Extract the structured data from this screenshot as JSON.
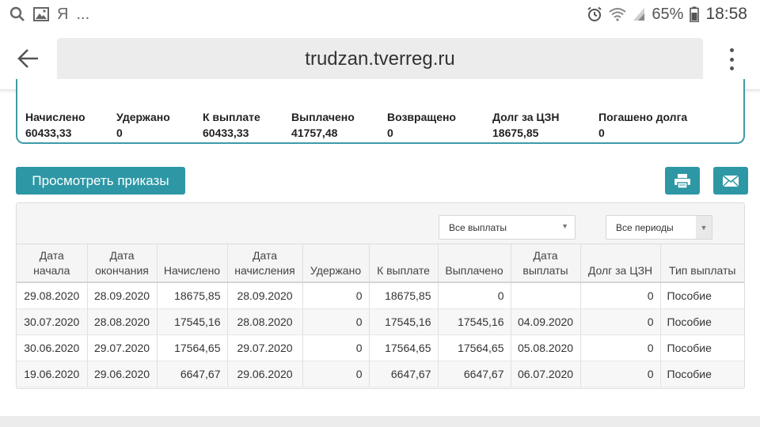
{
  "status_bar": {
    "carrier_glyph": "Я",
    "more": "...",
    "battery": "65%",
    "time": "18:58"
  },
  "browser": {
    "url": "trudzan.tverreg.ru"
  },
  "summary": {
    "items": [
      {
        "label": "Начислено",
        "value": "60433,33"
      },
      {
        "label": "Удержано",
        "value": "0"
      },
      {
        "label": "К выплате",
        "value": "60433,33"
      },
      {
        "label": "Выплачено",
        "value": "41757,48"
      },
      {
        "label": "Возвращено",
        "value": "0"
      },
      {
        "label": "Долг за ЦЗН",
        "value": "18675,85"
      },
      {
        "label": "Погашено долга",
        "value": "0"
      }
    ]
  },
  "actions": {
    "view_orders": "Просмотреть приказы"
  },
  "filters": {
    "payments": "Все выплаты",
    "periods": "Все периоды"
  },
  "table": {
    "headers": [
      "Дата начала",
      "Дата окончания",
      "Начислено",
      "Дата начисления",
      "Удержано",
      "К выплате",
      "Выплачено",
      "Дата выплаты",
      "Долг за ЦЗН",
      "Тип выплаты"
    ],
    "rows": [
      [
        "29.08.2020",
        "28.09.2020",
        "18675,85",
        "28.09.2020",
        "0",
        "18675,85",
        "0",
        "",
        "0",
        "Пособие"
      ],
      [
        "30.07.2020",
        "28.08.2020",
        "17545,16",
        "28.08.2020",
        "0",
        "17545,16",
        "17545,16",
        "04.09.2020",
        "0",
        "Пособие"
      ],
      [
        "30.06.2020",
        "29.07.2020",
        "17564,65",
        "29.07.2020",
        "0",
        "17564,65",
        "17564,65",
        "05.08.2020",
        "0",
        "Пособие"
      ],
      [
        "19.06.2020",
        "29.06.2020",
        "6647,67",
        "29.06.2020",
        "0",
        "6647,67",
        "6647,67",
        "06.07.2020",
        "0",
        "Пособие"
      ]
    ]
  },
  "colors": {
    "accent": "#2e97a5",
    "card_border": "#3d9ca8"
  }
}
